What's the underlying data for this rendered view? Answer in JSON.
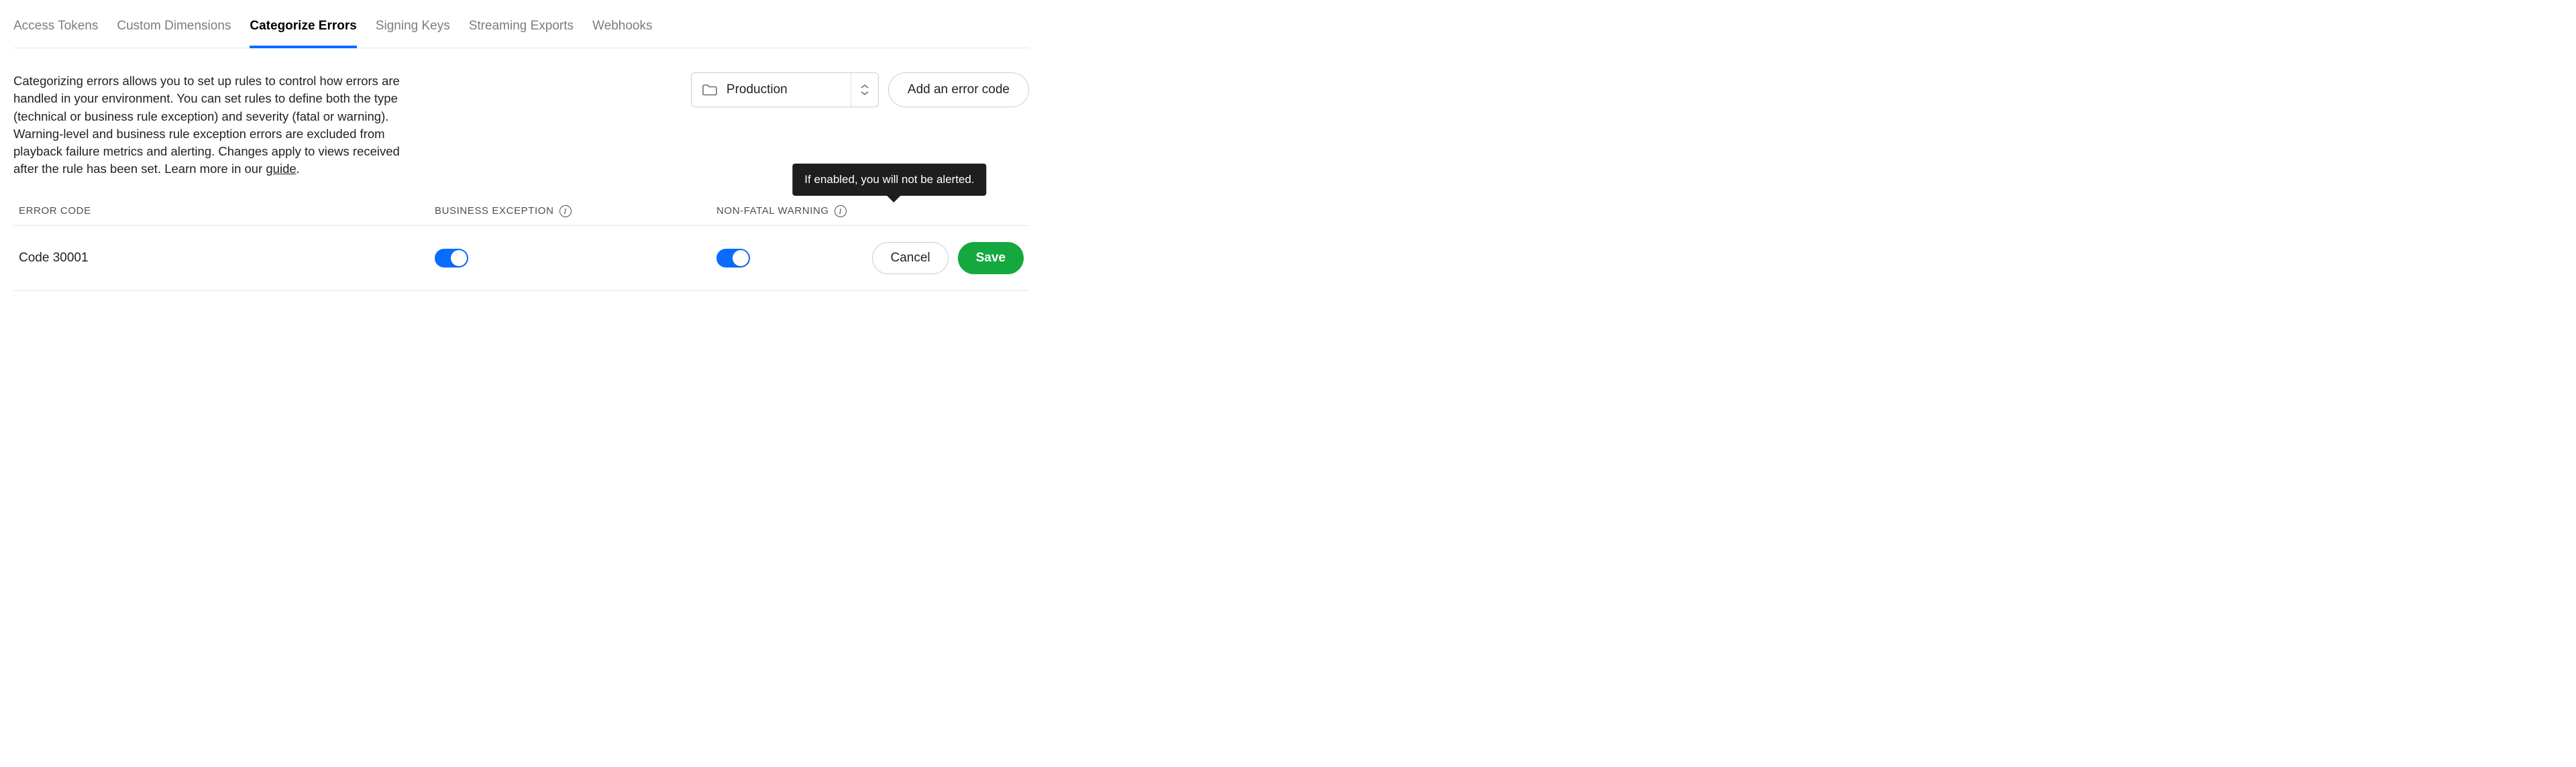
{
  "tabs": {
    "items": [
      {
        "label": "Access Tokens",
        "active": false
      },
      {
        "label": "Custom Dimensions",
        "active": false
      },
      {
        "label": "Categorize Errors",
        "active": true
      },
      {
        "label": "Signing Keys",
        "active": false
      },
      {
        "label": "Streaming Exports",
        "active": false
      },
      {
        "label": "Webhooks",
        "active": false
      }
    ]
  },
  "description": {
    "text": "Categorizing errors allows you to set up rules to control how errors are handled in your environment. You can set rules to define both the type (technical or business rule exception) and severity (fatal or warning). Warning-level and business rule exception errors are excluded from playback failure metrics and alerting. Changes apply to views received after the rule has been set. Learn more in our ",
    "link_label": "guide",
    "suffix": "."
  },
  "environment": {
    "selected": "Production"
  },
  "actions": {
    "add_error_code": "Add an error code",
    "cancel": "Cancel",
    "save": "Save"
  },
  "table": {
    "headers": {
      "error_code": "ERROR CODE",
      "business_exception": "BUSINESS EXCEPTION",
      "non_fatal_warning": "NON-FATAL WARNING"
    },
    "tooltip_non_fatal": "If enabled, you will not be alerted.",
    "rows": [
      {
        "code": "Code 30001",
        "business_exception_on": true,
        "non_fatal_warning_on": true
      }
    ]
  }
}
